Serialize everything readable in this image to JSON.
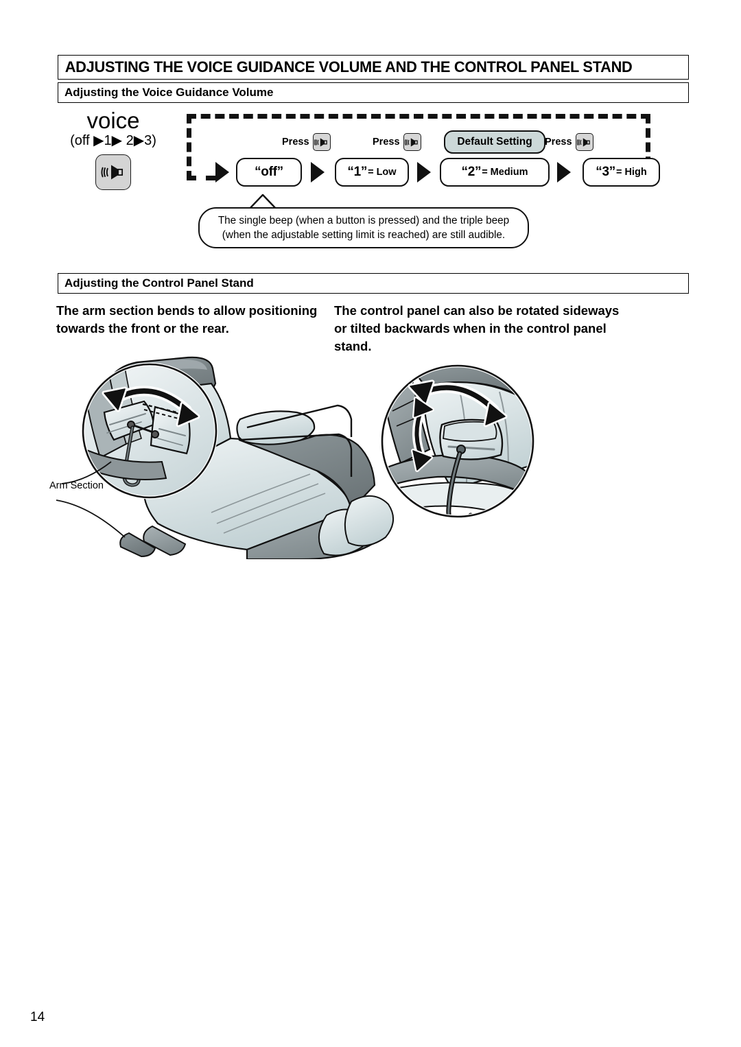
{
  "page": {
    "number": "14",
    "title": "ADJUSTING THE VOICE GUIDANCE VOLUME AND THE CONTROL PANEL STAND"
  },
  "sections": {
    "volume": {
      "heading": "Adjusting the Voice Guidance Volume",
      "voice_label": "voice",
      "voice_sequence": "(off ▶1▶ 2▶3)",
      "button_icon": "speaker-icon",
      "press_label": "Press",
      "default_setting_label": "Default Setting",
      "steps": [
        {
          "value": "“off”",
          "suffix": ""
        },
        {
          "value": "“1”",
          "suffix": "= Low"
        },
        {
          "value": "“2”",
          "suffix": "= Medium"
        },
        {
          "value": "“3”",
          "suffix": "= High"
        }
      ],
      "note_lines": [
        "The single beep (when a button is pressed) and the triple beep",
        "(when the adjustable setting limit is reached) are still audible."
      ]
    },
    "stand": {
      "heading": "Adjusting the Control Panel Stand",
      "description_left": "The arm section bends to allow positioning towards the front or the rear.",
      "description_right": "The control panel can also be rotated sideways or tilted backwards when in the control panel stand.",
      "arm_section_label": "Arm Section"
    }
  },
  "colors": {
    "ink": "#000000",
    "button_gray": "#d4d4d4",
    "default_tag": "#ccd8d8",
    "chair_dark": "#7b8386",
    "chair_mid": "#9aa3a6",
    "chair_light": "#c9d6d8",
    "chair_pale": "#e7eeef"
  }
}
